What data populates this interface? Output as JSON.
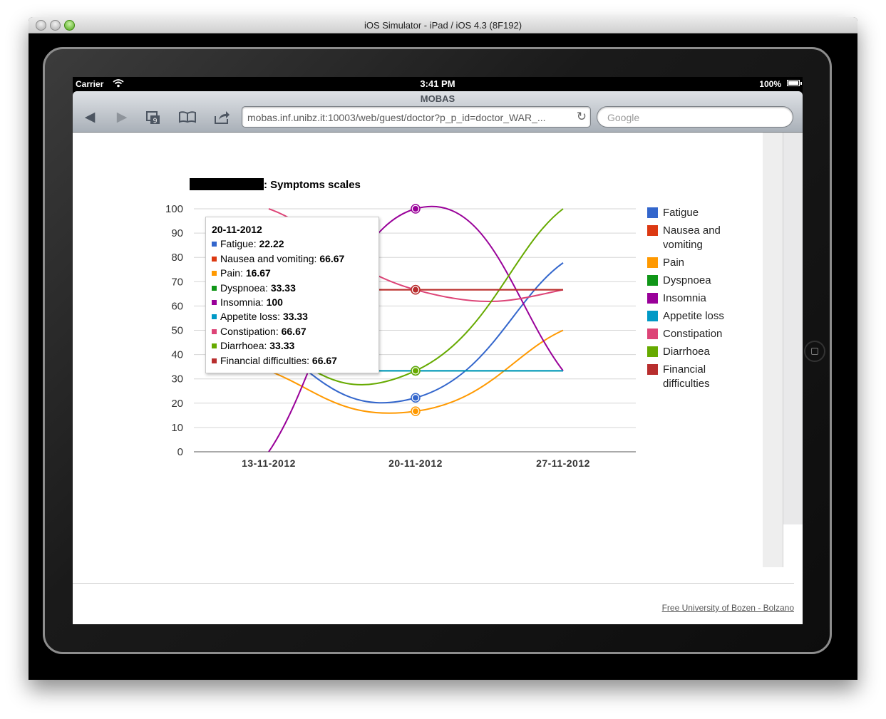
{
  "window": {
    "title": "iOS Simulator - iPad / iOS 4.3 (8F192)"
  },
  "status_bar": {
    "carrier": "Carrier",
    "time": "3:41 PM",
    "battery": "100%"
  },
  "browser": {
    "page_title": "MOBAS",
    "url": "mobas.inf.unibz.it:10003/web/guest/doctor?p_p_id=doctor_WAR_...",
    "search_placeholder": "Google",
    "tabs_count": "9"
  },
  "chart": {
    "title_suffix": ": Symptoms scales"
  },
  "tooltip": {
    "date": "20-11-2012",
    "rows": [
      {
        "label": "Fatigue: ",
        "value": "22.22",
        "color": "#3366cc"
      },
      {
        "label": "Nausea and vomiting: ",
        "value": "66.67",
        "color": "#dc3912"
      },
      {
        "label": "Pain: ",
        "value": "16.67",
        "color": "#ff9900"
      },
      {
        "label": "Dyspnoea: ",
        "value": "33.33",
        "color": "#109618"
      },
      {
        "label": "Insomnia: ",
        "value": "100",
        "color": "#990099"
      },
      {
        "label": "Appetite loss: ",
        "value": "33.33",
        "color": "#0099c6"
      },
      {
        "label": "Constipation: ",
        "value": "66.67",
        "color": "#dd4477"
      },
      {
        "label": "Diarrhoea: ",
        "value": "33.33",
        "color": "#66aa00"
      },
      {
        "label": "Financial difficulties: ",
        "value": "66.67",
        "color": "#b82e2e"
      }
    ]
  },
  "legend": {
    "items": [
      {
        "label": "Fatigue",
        "color": "#3366cc"
      },
      {
        "label": "Nausea and vomiting",
        "color": "#dc3912"
      },
      {
        "label": "Pain",
        "color": "#ff9900"
      },
      {
        "label": "Dyspnoea",
        "color": "#109618"
      },
      {
        "label": "Insomnia",
        "color": "#990099"
      },
      {
        "label": "Appetite loss",
        "color": "#0099c6"
      },
      {
        "label": "Constipation",
        "color": "#dd4477"
      },
      {
        "label": "Diarrhoea",
        "color": "#66aa00"
      },
      {
        "label": "Financial difficulties",
        "color": "#b82e2e"
      }
    ]
  },
  "footer": {
    "link": "Free University of Bozen - Bolzano"
  },
  "chart_data": {
    "type": "line",
    "title": ": Symptoms scales",
    "categories": [
      "13-11-2012",
      "20-11-2012",
      "27-11-2012"
    ],
    "ylim": [
      0,
      100
    ],
    "yticks": [
      "0",
      "10",
      "20",
      "30",
      "40",
      "50",
      "60",
      "70",
      "80",
      "90",
      "100"
    ],
    "grid": true,
    "legend_position": "right",
    "series": [
      {
        "name": "Fatigue",
        "color": "#3366cc",
        "values": [
          44.44,
          22.22,
          77.78
        ]
      },
      {
        "name": "Nausea and vomiting",
        "color": "#dc3912",
        "values": [
          66.67,
          66.67,
          66.67
        ]
      },
      {
        "name": "Pain",
        "color": "#ff9900",
        "values": [
          33.33,
          16.67,
          50
        ]
      },
      {
        "name": "Dyspnoea",
        "color": "#109618",
        "values": [
          33.33,
          33.33,
          33.33
        ]
      },
      {
        "name": "Insomnia",
        "color": "#990099",
        "values": [
          0,
          100,
          33.33
        ]
      },
      {
        "name": "Appetite loss",
        "color": "#0099c6",
        "values": [
          33.33,
          33.33,
          33.33
        ]
      },
      {
        "name": "Constipation",
        "color": "#dd4477",
        "values": [
          100,
          66.67,
          66.67
        ]
      },
      {
        "name": "Diarrhoea",
        "color": "#66aa00",
        "values": [
          44.44,
          33.33,
          100
        ]
      },
      {
        "name": "Financial difficulties",
        "color": "#b82e2e",
        "values": [
          66.67,
          66.67,
          66.67
        ]
      }
    ]
  }
}
